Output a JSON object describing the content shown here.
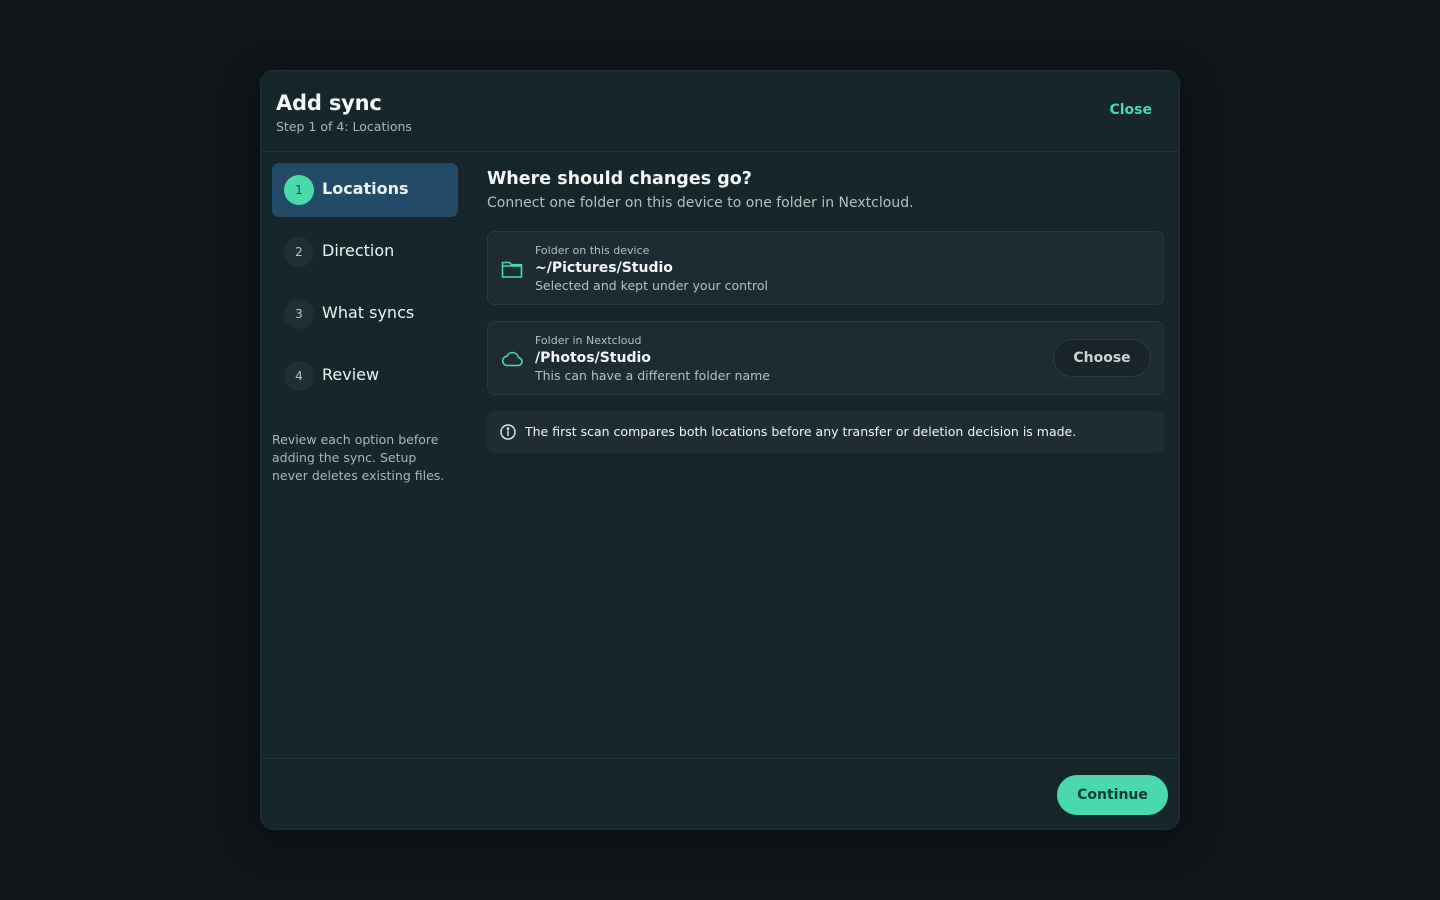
{
  "dialog": {
    "title": "Add sync",
    "subtitle": "Step 1 of 4: Locations",
    "close_label": "Close"
  },
  "steps": [
    {
      "number": "1",
      "label": "Locations",
      "active": true
    },
    {
      "number": "2",
      "label": "Direction",
      "active": false
    },
    {
      "number": "3",
      "label": "What syncs",
      "active": false
    },
    {
      "number": "4",
      "label": "Review",
      "active": false
    }
  ],
  "sidebar_note": "Review each option before adding the sync. Setup never deletes existing files.",
  "main": {
    "heading": "Where should changes go?",
    "description": "Connect one folder on this device to one folder in Nextcloud.",
    "local_folder": {
      "icon": "folder-icon",
      "kicker": "Folder on this device",
      "path": "~/Pictures/Studio",
      "hint": "Selected and kept under your control"
    },
    "remote_folder": {
      "icon": "cloud-icon",
      "kicker": "Folder in Nextcloud",
      "path": "/Photos/Studio",
      "hint": "This can have a different folder name",
      "choose_label": "Choose"
    },
    "info": {
      "icon": "info-icon",
      "text": "The first scan compares both locations before any transfer or deletion decision is made."
    }
  },
  "footer": {
    "continue_label": "Continue"
  },
  "colors": {
    "background": "#10151a",
    "dialog": "#16262a",
    "accent": "#4ad9ad",
    "active_step": "#234a66"
  }
}
